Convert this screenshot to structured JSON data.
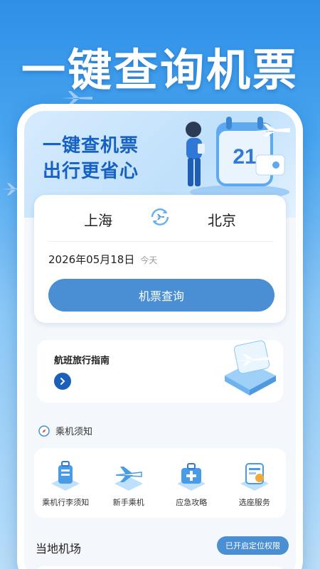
{
  "headline": "一键查询机票",
  "banner": {
    "title_line1": "一键查机票",
    "title_line2": "出行更省心",
    "calendar_number": "21"
  },
  "search": {
    "from_city": "上海",
    "to_city": "北京",
    "date": "2026年05月18日",
    "date_tag": "今天",
    "button_label": "机票查询"
  },
  "guide": {
    "title": "航班旅行指南"
  },
  "notice": {
    "title": "乘机须知",
    "items": [
      {
        "label": "乘机行李须知",
        "icon": "luggage-icon"
      },
      {
        "label": "新手乘机",
        "icon": "airplane-icon"
      },
      {
        "label": "应急攻略",
        "icon": "first-aid-kit-icon"
      },
      {
        "label": "选座服务",
        "icon": "seat-ticket-icon"
      }
    ]
  },
  "airport": {
    "title": "当地机场",
    "location_badge": "已开启定位权限"
  },
  "colors": {
    "accent": "#4a8fd4",
    "banner_text": "#1662c4",
    "background_top": "#2e8fe6"
  }
}
